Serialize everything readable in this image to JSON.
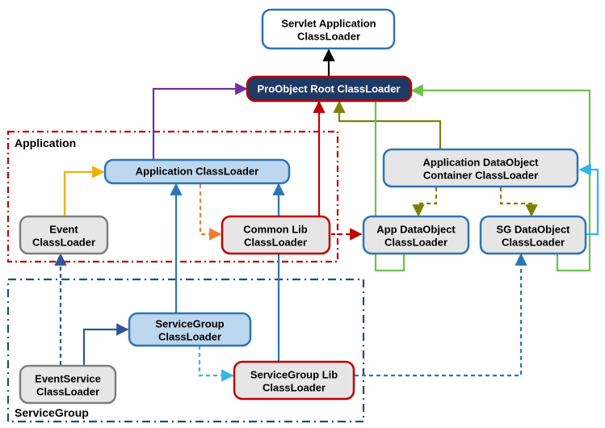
{
  "boxes": {
    "servlet": {
      "label1": "Servlet Application",
      "label2": "ClassLoader"
    },
    "root": {
      "label1": "ProObject Root ClassLoader"
    },
    "appCL": {
      "label1": "Application ClassLoader"
    },
    "eventCL": {
      "label1": "Event",
      "label2": "ClassLoader"
    },
    "commonLib": {
      "label1": "Common Lib",
      "label2": "ClassLoader"
    },
    "appDOcont": {
      "label1": "Application DataObject",
      "label2": "Container ClassLoader"
    },
    "appDO": {
      "label1": "App DataObject",
      "label2": "ClassLoader"
    },
    "sgDO": {
      "label1": "SG DataObject",
      "label2": "ClassLoader"
    },
    "sgCL": {
      "label1": "ServiceGroup",
      "label2": "ClassLoader"
    },
    "evtSvc": {
      "label1": "EventService",
      "label2": "ClassLoader"
    },
    "sgLib": {
      "label1": "ServiceGroup Lib",
      "label2": "ClassLoader"
    }
  },
  "groups": {
    "application": {
      "label": "Application"
    },
    "serviceGroup": {
      "label": "ServiceGroup"
    }
  },
  "chart_data": {
    "type": "graph",
    "title": "",
    "nodes": [
      {
        "id": "servlet",
        "label": "Servlet Application ClassLoader"
      },
      {
        "id": "root",
        "label": "ProObject Root ClassLoader"
      },
      {
        "id": "appCL",
        "label": "Application ClassLoader",
        "group": "Application"
      },
      {
        "id": "eventCL",
        "label": "Event ClassLoader",
        "group": "Application"
      },
      {
        "id": "commonLib",
        "label": "Common Lib ClassLoader",
        "group": "Application"
      },
      {
        "id": "appDOcont",
        "label": "Application DataObject Container ClassLoader"
      },
      {
        "id": "appDO",
        "label": "App DataObject ClassLoader"
      },
      {
        "id": "sgDO",
        "label": "SG DataObject ClassLoader"
      },
      {
        "id": "sgCL",
        "label": "ServiceGroup ClassLoader",
        "group": "ServiceGroup"
      },
      {
        "id": "evtSvc",
        "label": "EventService ClassLoader",
        "group": "ServiceGroup"
      },
      {
        "id": "sgLib",
        "label": "ServiceGroup Lib ClassLoader",
        "group": "ServiceGroup"
      }
    ],
    "groups": [
      {
        "id": "Application",
        "label": "Application"
      },
      {
        "id": "ServiceGroup",
        "label": "ServiceGroup"
      }
    ],
    "edges": [
      {
        "from": "root",
        "to": "servlet",
        "style": "solid",
        "color": "black"
      },
      {
        "from": "appCL",
        "to": "root",
        "style": "solid",
        "color": "purple"
      },
      {
        "from": "eventCL",
        "to": "appCL",
        "style": "solid",
        "color": "yellow"
      },
      {
        "from": "commonLib",
        "to": "root",
        "style": "solid",
        "color": "red"
      },
      {
        "from": "appCL",
        "to": "commonLib",
        "style": "dashed",
        "color": "orange"
      },
      {
        "from": "commonLib",
        "to": "appDO",
        "style": "dashed",
        "color": "red"
      },
      {
        "from": "appDOcont",
        "to": "root",
        "style": "solid",
        "color": "olive"
      },
      {
        "from": "appDOcont",
        "to": "appDO",
        "style": "dashed",
        "color": "olive"
      },
      {
        "from": "appDOcont",
        "to": "sgDO",
        "style": "dashed",
        "color": "olive"
      },
      {
        "from": "appDO",
        "to": "root",
        "style": "solid",
        "color": "green"
      },
      {
        "from": "sgDO",
        "to": "root",
        "style": "solid",
        "color": "green"
      },
      {
        "from": "sgDO",
        "to": "appDOcont",
        "style": "solid",
        "color": "skyblue"
      },
      {
        "from": "sgCL",
        "to": "appCL",
        "style": "solid",
        "color": "teal"
      },
      {
        "from": "evtSvc",
        "to": "sgCL",
        "style": "solid",
        "color": "blue"
      },
      {
        "from": "evtSvc",
        "to": "eventCL",
        "style": "dashed",
        "color": "blue"
      },
      {
        "from": "sgCL",
        "to": "sgLib",
        "style": "dashed",
        "color": "skyblue"
      },
      {
        "from": "sgLib",
        "to": "appCL",
        "style": "solid",
        "color": "teal"
      },
      {
        "from": "sgLib",
        "to": "sgDO",
        "style": "dashed",
        "color": "teal"
      }
    ]
  }
}
